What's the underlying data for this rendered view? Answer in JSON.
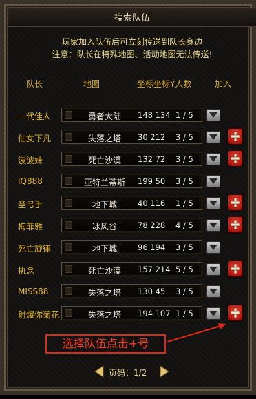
{
  "window": {
    "title": "搜索队伍"
  },
  "notice": {
    "line1": "玩家加入队伍后可立刻传送到队长身边",
    "line2": "注意：队长在特殊地图、活动地图无法传送!"
  },
  "columns": {
    "leader": "队长",
    "map": "地图",
    "coord": "坐标",
    "coord_count": "坐标Y人数",
    "join": "加入"
  },
  "rows": [
    {
      "leader": "一代佳人",
      "map": "勇者大陆",
      "coord": "148 134",
      "count": "1 / 5",
      "joinable": false
    },
    {
      "leader": "仙女下凡",
      "map": "失落之塔",
      "coord": "30  212",
      "count": "3 / 5",
      "joinable": true
    },
    {
      "leader": "波波妹",
      "map": "死亡沙漠",
      "coord": "132 72",
      "count": "3 / 5",
      "joinable": true
    },
    {
      "leader": "IQ888",
      "map": "亚特兰蒂斯",
      "coord": "199 50",
      "count": "3 / 5",
      "joinable": false
    },
    {
      "leader": "圣弓手",
      "map": "地下城",
      "coord": "40  116",
      "count": "1 / 5",
      "joinable": true
    },
    {
      "leader": "梅菲雅",
      "map": "冰风谷",
      "coord": "78  228",
      "count": "4 / 5",
      "joinable": true
    },
    {
      "leader": "死亡旋律",
      "map": "地下城",
      "coord": "96  194",
      "count": "3 / 5",
      "joinable": false
    },
    {
      "leader": "执念",
      "map": "死亡沙漠",
      "coord": "157 214",
      "count": "5 / 5",
      "joinable": true
    },
    {
      "leader": "MISS88",
      "map": "失落之塔",
      "coord": "130 45",
      "count": "3 / 5",
      "joinable": false
    },
    {
      "leader": "射爆你菊花",
      "map": "失落之塔",
      "coord": "194 107",
      "count": "1 / 5",
      "joinable": true
    }
  ],
  "callout": {
    "text": "选择队伍点击+号"
  },
  "pager": {
    "label": "页码：",
    "current": "1/2"
  },
  "colors": {
    "leader": "#e0b52c",
    "header": "#d7a92c",
    "notice": "#e9d68a",
    "callout": "#ff3a22"
  },
  "icons": {
    "dropdown": "chevron-down-icon",
    "join": "plus-icon",
    "prev": "arrow-left-icon",
    "next": "arrow-right-icon"
  }
}
